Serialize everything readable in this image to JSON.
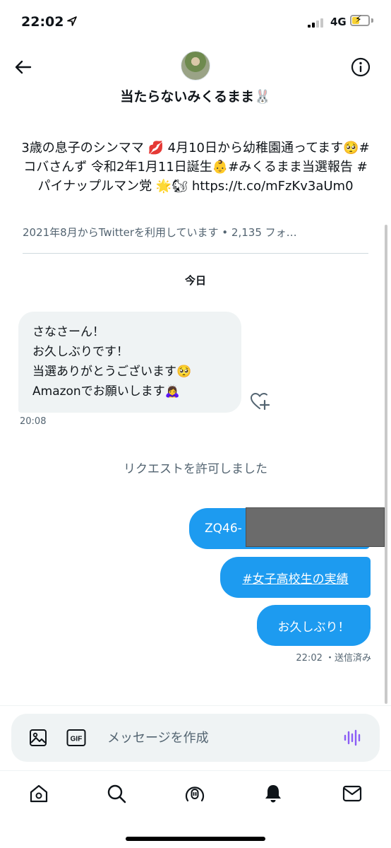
{
  "status_bar": {
    "time": "22:02",
    "network": "4G",
    "icons": [
      "location-arrow-icon",
      "signal-icon",
      "battery-charging-icon"
    ]
  },
  "header": {
    "display_name": "当たらないみくるまま🐰",
    "icons": [
      "back-arrow-icon",
      "info-icon"
    ]
  },
  "profile": {
    "bio": "3歳の息子のシンママ 💋 4月10日から幼稚園通ってます🥺#コバさんず 令和2年1月11日誕生👶#みくるまま当選報告 #パイナップルマン党 🌟🐿 https://t.co/mFzKv3aUm0",
    "meta": "2021年8月からTwitterを利用しています • 2,135 フォ…"
  },
  "conversation": {
    "date_separator": "今日",
    "received": {
      "lines": [
        "さなさーん！",
        "お久しぶりです！",
        "当選ありがとうございます🥺",
        "Amazonでお願いします🙇‍♀️"
      ],
      "time": "20:08"
    },
    "system_note": "リクエストを許可しました",
    "sent": [
      {
        "text": "ZQ46-"
      },
      {
        "text": "#女子高校生の実績"
      },
      {
        "text": "お久しぶり！"
      }
    ],
    "sent_status": "22:02 ・送信済み"
  },
  "composer": {
    "placeholder": "メッセージを作成",
    "gif_label": "GIF",
    "icons": [
      "image-icon",
      "gif-icon",
      "voice-icon"
    ]
  },
  "tabbar": {
    "icons": [
      "home-icon",
      "search-icon",
      "spaces-icon",
      "notifications-icon",
      "messages-icon"
    ]
  },
  "colors": {
    "accent": "#1d9bf0",
    "secondary_text": "#536471",
    "bubble_received": "#eff3f4",
    "voice_icon": "#8b5cf6"
  }
}
